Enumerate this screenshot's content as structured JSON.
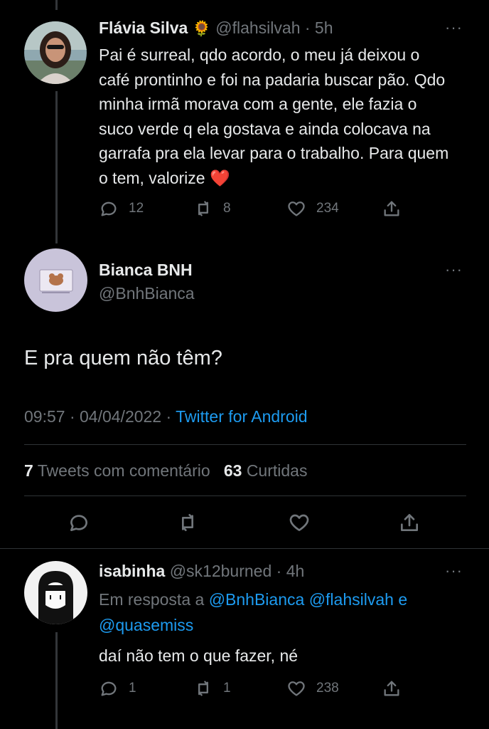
{
  "tweet1": {
    "name": "Flávia Silva",
    "badge_emoji": "🌻",
    "handle": "@flahsilvah",
    "time": "· 5h",
    "text": "Pai é surreal, qdo acordo, o meu já deixou o café prontinho e foi na padaria buscar pão. Qdo minha irmã morava com a gente, ele fazia o suco verde q ela gostava e ainda colocava na garrafa pra ela levar para o trabalho. Para quem o tem, valorize ❤️",
    "replies": "12",
    "retweets": "8",
    "likes": "234"
  },
  "main_tweet": {
    "name": "Bianca BNH",
    "handle": "@BnhBianca",
    "text": "E pra quem não têm?",
    "timestamp": "09:57 · 04/04/2022 ·",
    "source": "Twitter for Android",
    "quote_count": "7",
    "quote_label": "Tweets com comentário",
    "like_count": "63",
    "like_label": "Curtidas"
  },
  "reply": {
    "name": "isabinha",
    "handle": "@sk12burned",
    "time": "· 4h",
    "reply_prefix": "Em resposta a",
    "mention1": "@BnhBianca",
    "mention2": "@flahsilvah",
    "and": "e",
    "mention3": "@quasemiss",
    "text": "daí não tem o que fazer, né",
    "replies": "1",
    "retweets": "1",
    "likes": "238"
  },
  "colors": {
    "background": "#000000",
    "text": "#e7e9ea",
    "muted": "#71767b",
    "accent": "#1d9bf0",
    "heart": "#f4212e"
  }
}
